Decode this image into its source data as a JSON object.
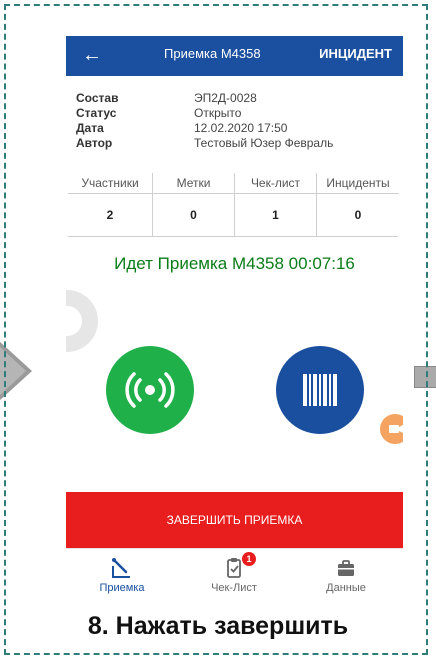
{
  "header": {
    "title": "Приемка М4358",
    "incident_label": "ИНЦИДЕНТ"
  },
  "info": [
    {
      "label": "Состав",
      "value": "ЭП2Д-0028"
    },
    {
      "label": "Статус",
      "value": "Открыто"
    },
    {
      "label": "Дата",
      "value": "12.02.2020 17:50"
    },
    {
      "label": "Автор",
      "value": "Тестовый Юзер Февраль"
    }
  ],
  "stats": [
    {
      "label": "Участники",
      "value": "2"
    },
    {
      "label": "Метки",
      "value": "0"
    },
    {
      "label": "Чек-лист",
      "value": "1"
    },
    {
      "label": "Инциденты",
      "value": "0"
    }
  ],
  "session_status": "Идет Приемка М4358 00:07:16",
  "finish_button": "ЗАВЕРШИТЬ ПРИЕМКА",
  "bottom_nav": [
    {
      "label": "Приемка",
      "icon": "acceptance-icon",
      "active": true
    },
    {
      "label": "Чек-Лист",
      "icon": "checklist-icon",
      "badge": "1"
    },
    {
      "label": "Данные",
      "icon": "briefcase-icon"
    }
  ],
  "caption": "8. Нажать завершить",
  "colors": {
    "appbar": "#1b4fa0",
    "nfc": "#1fb04a",
    "scan": "#1a4f9f",
    "finish": "#e81e1e",
    "session_text": "#0b7d18",
    "nav_active": "#1b4fa0",
    "frame": "#2e7d7a"
  }
}
